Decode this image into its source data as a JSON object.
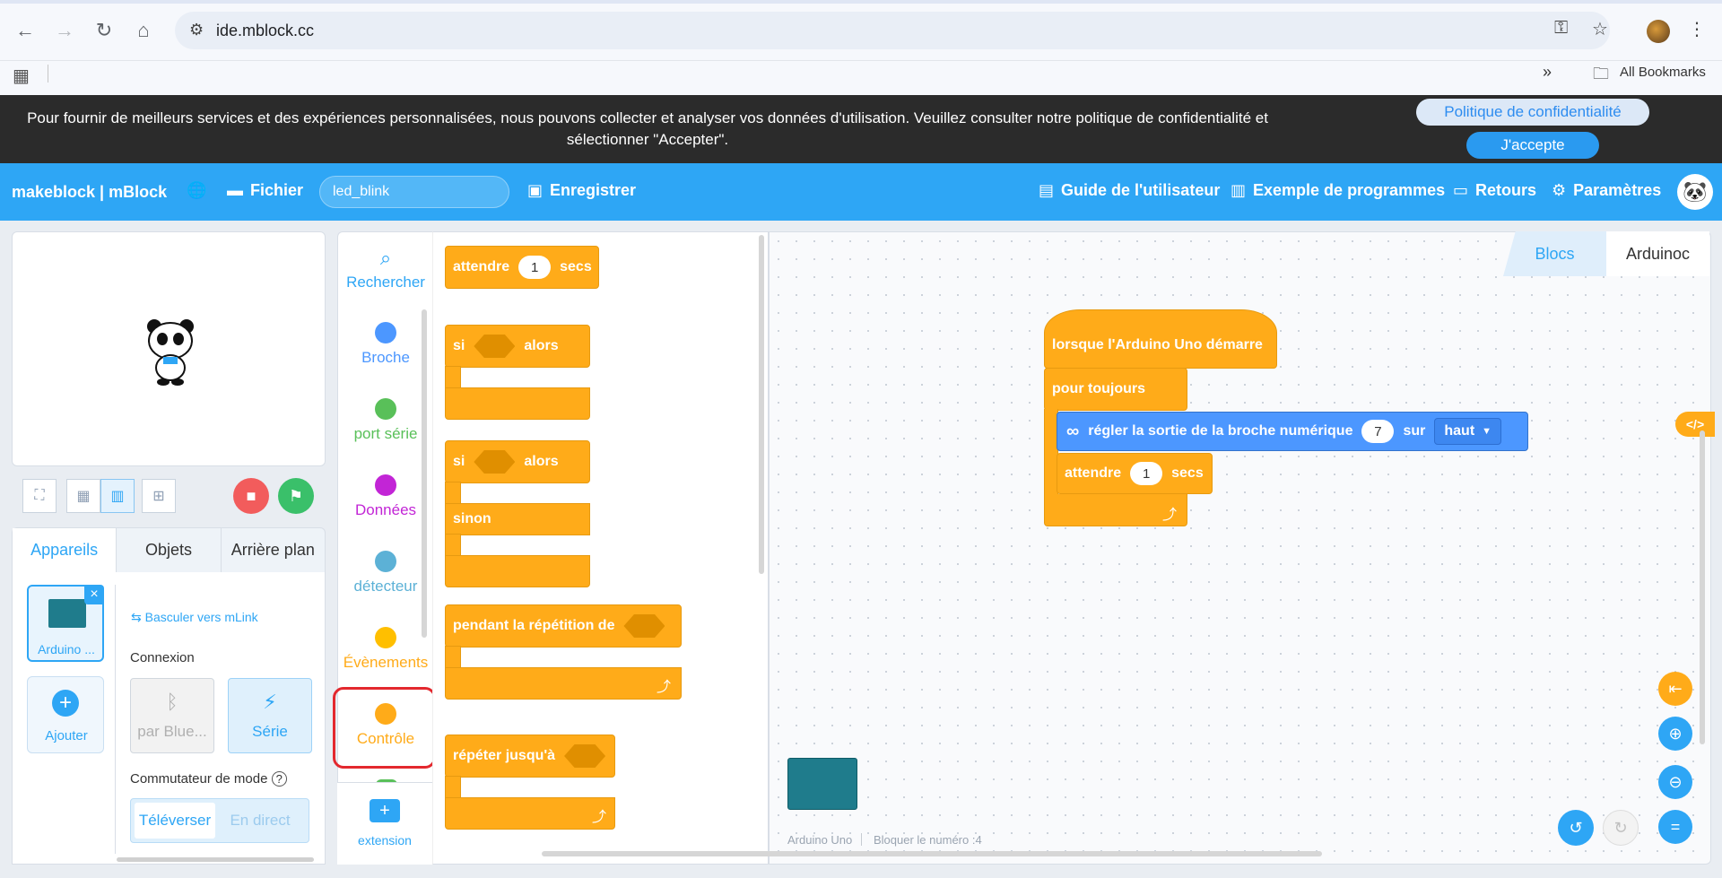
{
  "browser": {
    "url": "ide.mblock.cc",
    "bookmarks_label": "All Bookmarks"
  },
  "cookie": {
    "message": "Pour fournir de meilleurs services et des expériences personnalisées, nous pouvons collecter et analyser vos données d'utilisation. Veuillez consulter notre politique de confidentialité et sélectionner \"Accepter\".",
    "privacy_label": "Politique de confidentialité",
    "accept_label": "J'accepte"
  },
  "appbar": {
    "logo": "makeblock | mBlock",
    "file": "Fichier",
    "project_name": "led_blink",
    "save": "Enregistrer",
    "guide": "Guide de l'utilisateur",
    "examples": "Exemple de programmes",
    "feedback": "Retours",
    "settings": "Paramètres"
  },
  "left_tabs": [
    "Appareils",
    "Objets",
    "Arrière plan"
  ],
  "devices": {
    "device_label": "Arduino ...",
    "add_label": "Ajouter",
    "mlink": "Basculer vers mLink",
    "connection_label": "Connexion",
    "bluetooth": "par Blue...",
    "serial": "Série",
    "mode_label": "Commutateur de mode",
    "upload": "Téléverser",
    "live": "En direct"
  },
  "categories": [
    {
      "label": "Rechercher",
      "color": "#2ea6f5"
    },
    {
      "label": "Broche",
      "color": "#4c97ff"
    },
    {
      "label": "port série",
      "color": "#59c059"
    },
    {
      "label": "Données",
      "color": "#c225d6"
    },
    {
      "label": "détecteur",
      "color": "#5cb1d6"
    },
    {
      "label": "Évènements",
      "color": "#ffbf00"
    },
    {
      "label": "Contrôle",
      "color": "#ffab19"
    }
  ],
  "extension_label": "extension",
  "palette_blocks": {
    "wait": "attendre",
    "wait_value": "1",
    "secs": "secs",
    "if": "si",
    "then": "alors",
    "else": "sinon",
    "while": "pendant la répétition de",
    "until": "répéter jusqu'à"
  },
  "workspace": {
    "tabs": [
      "Blocs",
      "Arduinoc"
    ],
    "hat": "lorsque l'Arduino Uno démarre",
    "forever": "pour toujours",
    "set_pin": "régler la sortie de la broche numérique",
    "pin": "7",
    "on": "sur",
    "level": "haut",
    "wait": "attendre",
    "wait_value": "1",
    "secs": "secs",
    "footer_device": "Arduino Uno",
    "footer_block": "Bloquer le numéro :4"
  },
  "colors": {
    "brand": "#2ea6f5",
    "control": "#ffab19",
    "pin": "#4c97ff"
  }
}
